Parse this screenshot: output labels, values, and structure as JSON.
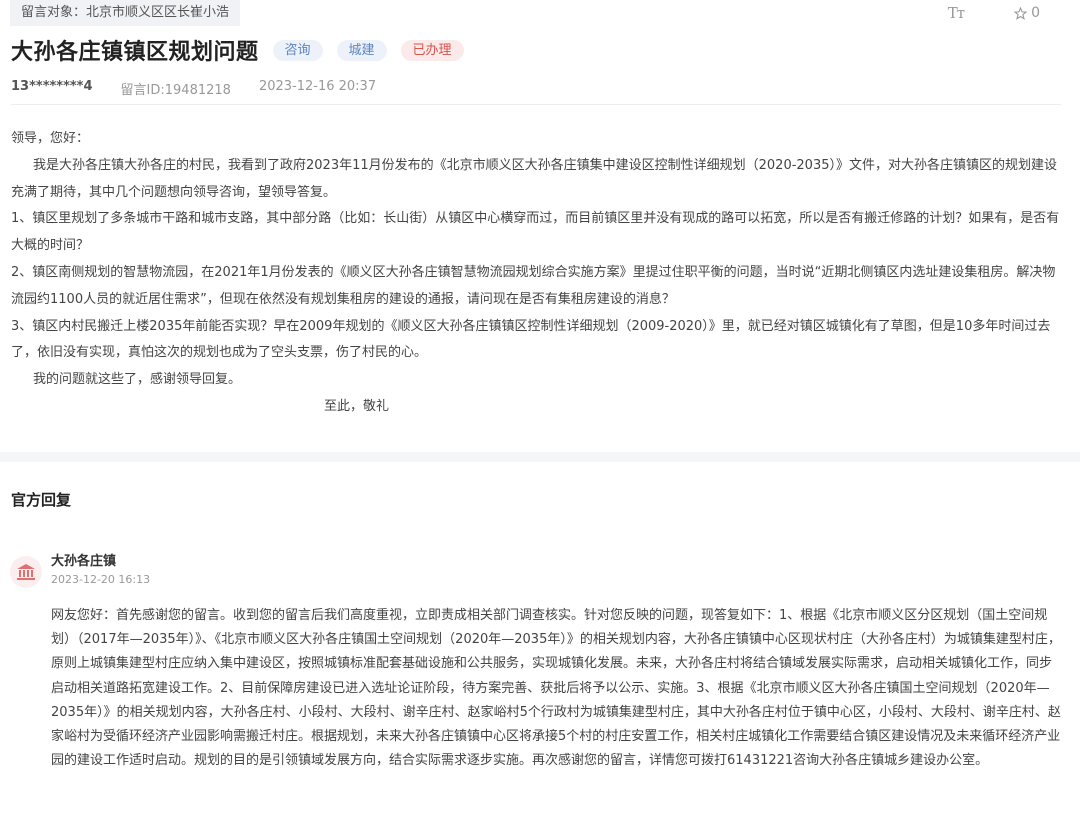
{
  "header": {
    "target_label": "留言对象：北京市顺义区区长崔小浩",
    "font_size_label": "Tт",
    "favorite_count": "0",
    "title": "大孙各庄镇镇区规划问题",
    "tags": [
      "咨询",
      "城建",
      "已办理"
    ],
    "author": "13********4",
    "message_id": "留言ID:19481218",
    "timestamp": "2023-12-16 20:37"
  },
  "message": {
    "greeting": "领导，您好：",
    "paragraphs": [
      "我是大孙各庄镇大孙各庄的村民，我看到了政府2023年11月份发布的《北京市顺义区大孙各庄镇集中建设区控制性详细规划（2020-2035）》文件，对大孙各庄镇镇区的规划建设充满了期待，其中几个问题想向领导咨询，望领导答复。",
      "1、镇区里规划了多条城市干路和城市支路，其中部分路（比如：长山街）从镇区中心横穿而过，而目前镇区里并没有现成的路可以拓宽，所以是否有搬迁修路的计划？如果有，是否有大概的时间？",
      "2、镇区南侧规划的智慧物流园，在2021年1月份发表的《顺义区大孙各庄镇智慧物流园规划综合实施方案》里提过住职平衡的问题，当时说“近期北侧镇区内选址建设集租房。解决物流园约1100人员的就近居住需求”，但现在依然没有规划集租房的建设的通报，请问现在是否有集租房建设的消息？",
      "3、镇区内村民搬迁上楼2035年前能否实现？早在2009年规划的《顺义区大孙各庄镇镇区控制性详细规划（2009-2020）》里，就已经对镇区城镇化有了草图，但是10多年时间过去了，依旧没有实现，真怕这次的规划也成为了空头支票，伤了村民的心。",
      "我的问题就这些了，感谢领导回复。"
    ],
    "closing": "至此，敬礼"
  },
  "reply": {
    "heading": "官方回复",
    "org_name": "大孙各庄镇",
    "time": "2023-12-20 16:13",
    "text": "网友您好：首先感谢您的留言。收到您的留言后我们高度重视，立即责成相关部门调查核实。针对您反映的问题，现答复如下：1、根据《北京市顺义区分区规划（国土空间规划）（2017年—2035年）》、《北京市顺义区大孙各庄镇国土空间规划（2020年—2035年）》的相关规划内容，大孙各庄镇镇中心区现状村庄（大孙各庄村）为城镇集建型村庄，原则上城镇集建型村庄应纳入集中建设区，按照城镇标准配套基础设施和公共服务，实现城镇化发展。未来，大孙各庄村将结合镇域发展实际需求，启动相关城镇化工作，同步启动相关道路拓宽建设工作。2、目前保障房建设已进入选址论证阶段，待方案完善、获批后将予以公示、实施。3、根据《北京市顺义区大孙各庄镇国土空间规划（2020年—2035年）》的相关规划内容，大孙各庄村、小段村、大段村、谢辛庄村、赵家峪村5个行政村为城镇集建型村庄，其中大孙各庄村位于镇中心区，小段村、大段村、谢辛庄村、赵家峪村为受循环经济产业园影响需搬迁村庄。根据规划，未来大孙各庄镇镇中心区将承接5个村的村庄安置工作，相关村庄城镇化工作需要结合镇区建设情况及未来循环经济产业园的建设工作适时启动。规划的目的是引领镇域发展方向，结合实际需求逐步实施。再次感谢您的留言，详情您可拨打61431221咨询大孙各庄镇城乡建设办公室。"
  },
  "colors": {
    "accent_blue": "#5d85c2",
    "status_red": "#d9534f",
    "avatar_icon": "#e07070"
  },
  "icons": [
    "font-size-icon",
    "star-icon",
    "government-building-icon"
  ]
}
